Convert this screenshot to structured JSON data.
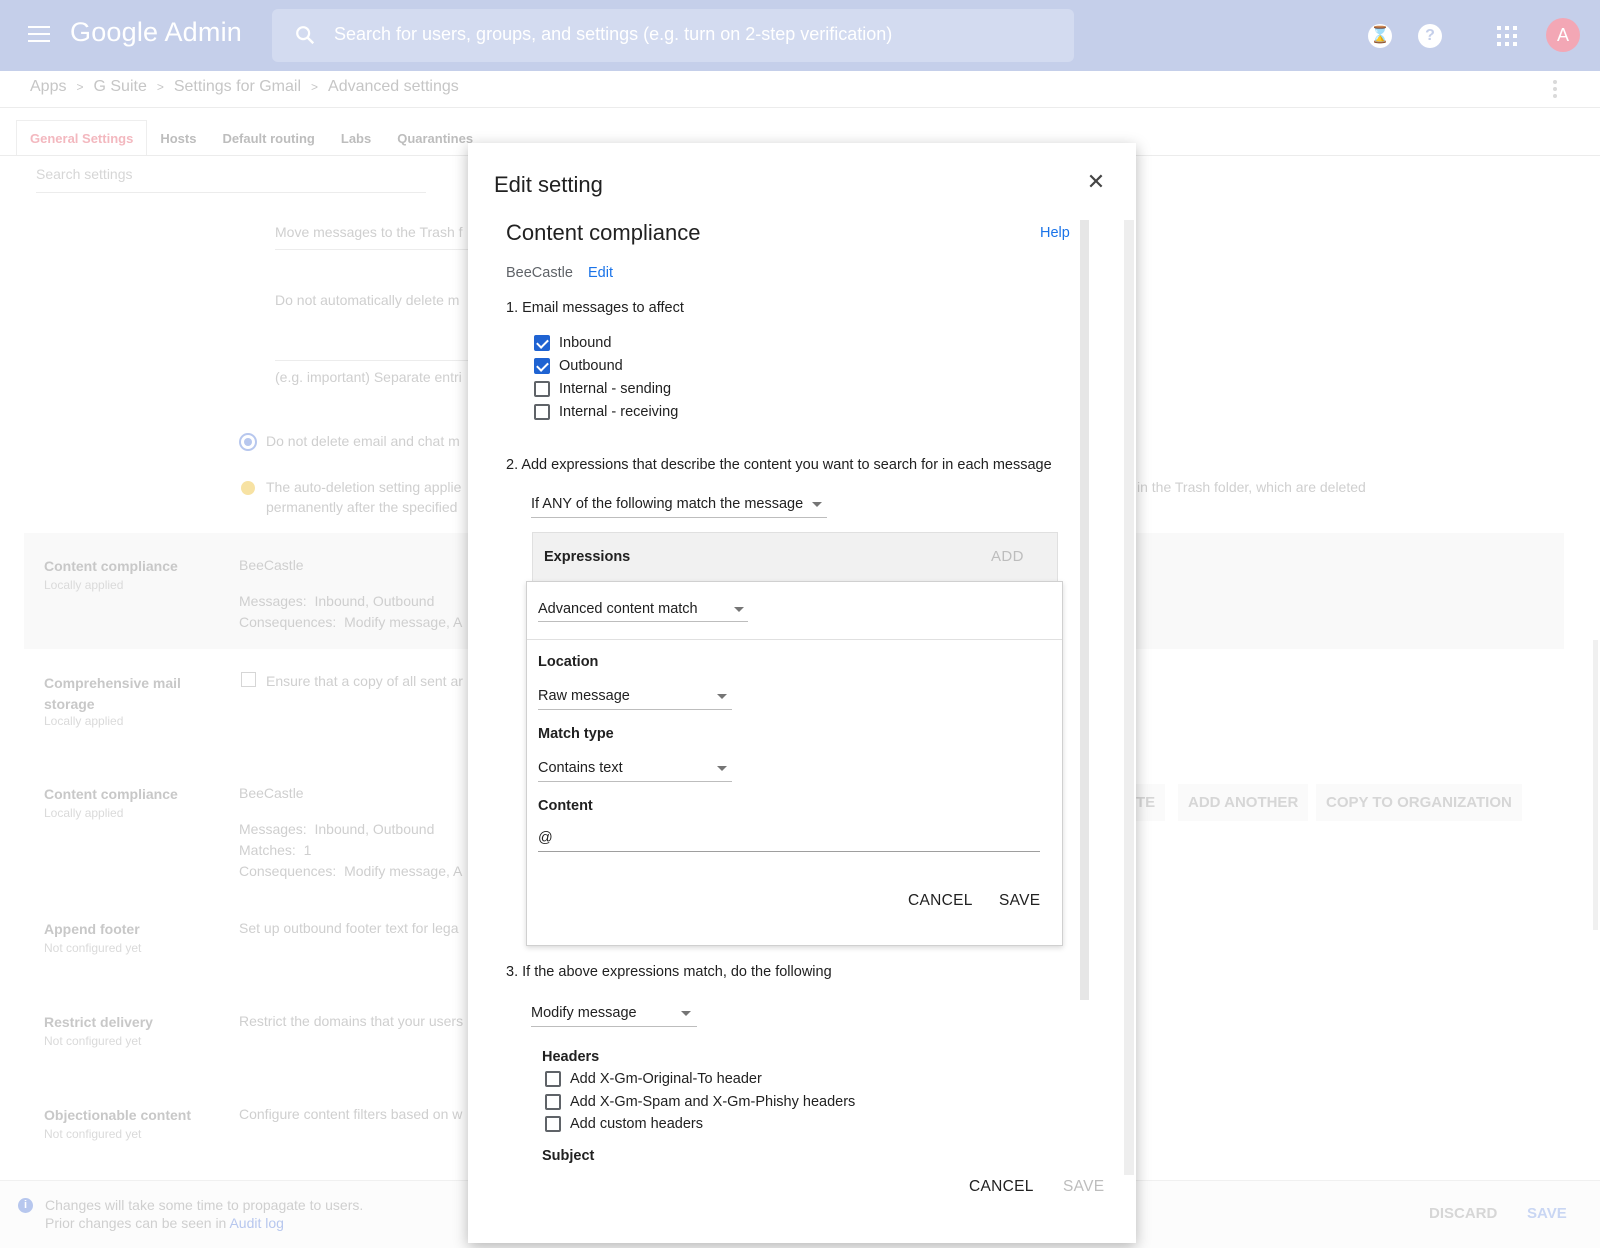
{
  "header": {
    "logo": "Google Admin",
    "search_placeholder": "Search for users, groups, and settings (e.g. turn on 2-step verification)",
    "avatar_letter": "A"
  },
  "breadcrumb": [
    "Apps",
    "G Suite",
    "Settings for Gmail",
    "Advanced settings"
  ],
  "tabs": [
    "General Settings",
    "Hosts",
    "Default routing",
    "Labs",
    "Quarantines"
  ],
  "settings_search_placeholder": "Search settings",
  "background": {
    "trash_row": "Move messages to the Trash f",
    "no_delete_row": "Do not automatically delete m",
    "label_placeholder": "(e.g. important) Separate entri",
    "radio_label": "Do not delete email and chat m",
    "autodelete_note_1": "The auto-deletion setting applie",
    "autodelete_note_2": "permanently after the specified",
    "autodelete_note_right": "in the Trash folder, which are deleted",
    "settings": [
      {
        "title": "Content compliance",
        "status": "Locally applied",
        "ou": "BeeCastle",
        "lines": [
          {
            "k": "Messages:",
            "v": "Inbound, Outbound"
          },
          {
            "k": "Consequences:",
            "v": "Modify message, A"
          }
        ]
      },
      {
        "title": "Comprehensive mail storage",
        "status": "Locally applied",
        "desc": "Ensure that a copy of all sent ar"
      },
      {
        "title": "Content compliance",
        "status": "Locally applied",
        "ou": "BeeCastle",
        "lines": [
          {
            "k": "Messages:",
            "v": "Inbound, Outbound"
          },
          {
            "k": "Matches:",
            "v": "1"
          },
          {
            "k": "Consequences:",
            "v": "Modify message, A"
          }
        ]
      },
      {
        "title": "Append footer",
        "status": "Not configured yet",
        "desc": "Set up outbound footer text for lega"
      },
      {
        "title": "Restrict delivery",
        "status": "Not configured yet",
        "desc": "Restrict the domains that your users"
      },
      {
        "title": "Objectionable content",
        "status": "Not configured yet",
        "desc": "Configure content filters based on w"
      }
    ],
    "row_buttons": [
      "TE",
      "ADD ANOTHER",
      "COPY TO ORGANIZATION"
    ]
  },
  "bottom_bar": {
    "note_1": "Changes will take some time to propagate to users.",
    "note_2": "Prior changes can be seen in",
    "audit_link": "Audit log",
    "discard": "DISCARD",
    "save": "SAVE"
  },
  "dialog": {
    "title": "Edit setting",
    "setting_name": "Content compliance",
    "help": "Help",
    "ou_name": "BeeCastle",
    "ou_edit": "Edit",
    "step1": "1. Email messages to affect",
    "message_types": [
      {
        "label": "Inbound",
        "checked": true
      },
      {
        "label": "Outbound",
        "checked": true
      },
      {
        "label": "Internal - sending",
        "checked": false
      },
      {
        "label": "Internal - receiving",
        "checked": false
      }
    ],
    "step2": "2. Add expressions that describe the content you want to search for in each message",
    "match_mode": "If ANY of the following match the message",
    "expressions_label": "Expressions",
    "add_label": "ADD",
    "expression": {
      "type": "Advanced content match",
      "location_label": "Location",
      "location_value": "Raw message",
      "match_type_label": "Match type",
      "match_type_value": "Contains text",
      "content_label": "Content",
      "content_value": "@",
      "cancel": "CANCEL",
      "save": "SAVE"
    },
    "step3": "3. If the above expressions match, do the following",
    "action": "Modify message",
    "headers_label": "Headers",
    "header_options": [
      {
        "label": "Add X-Gm-Original-To header",
        "checked": false
      },
      {
        "label": "Add X-Gm-Spam and X-Gm-Phishy headers",
        "checked": false
      },
      {
        "label": "Add custom headers",
        "checked": false
      }
    ],
    "subject_label": "Subject",
    "cancel": "CANCEL",
    "save": "SAVE"
  },
  "colors": {
    "accent": "#1a73e8",
    "checkbox": "#1f63d2",
    "topbar": "#c5cfea"
  }
}
